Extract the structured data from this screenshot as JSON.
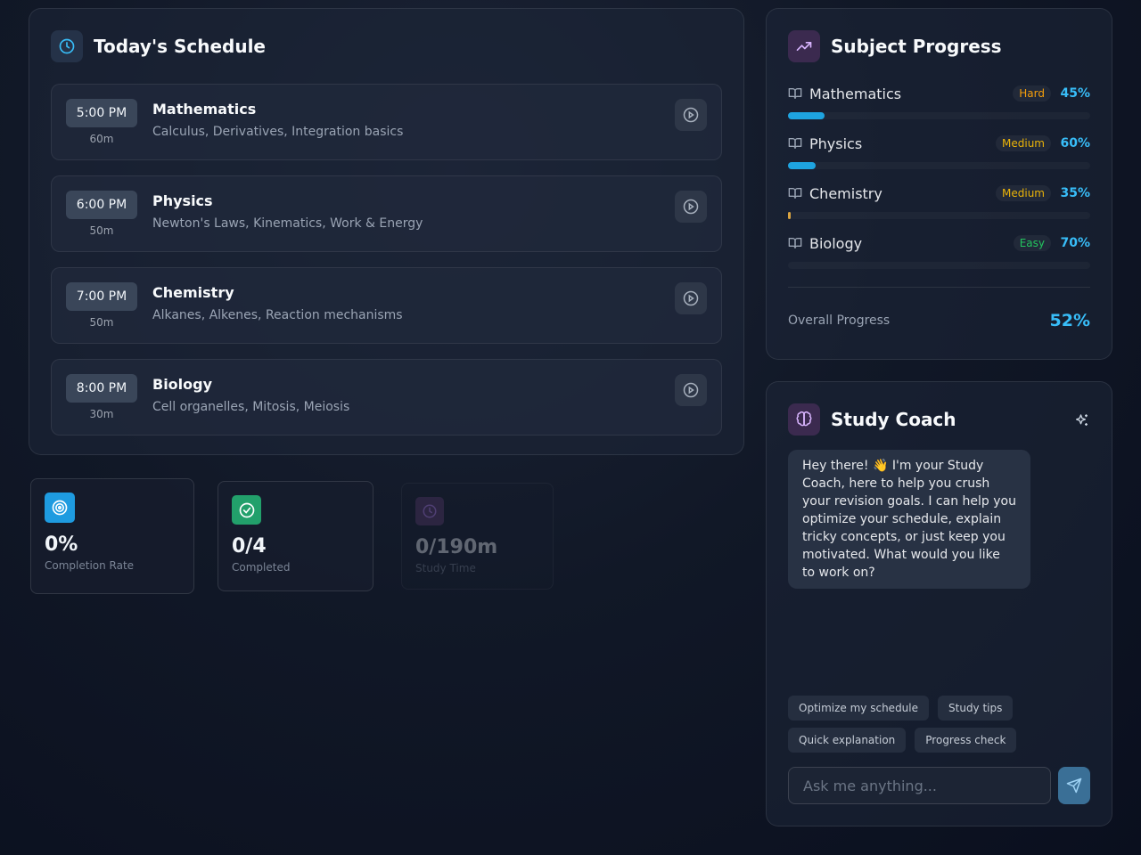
{
  "schedule": {
    "title": "Today's Schedule",
    "items": [
      {
        "time": "5:00 PM",
        "duration": "60m",
        "subject": "Mathematics",
        "topics": "Calculus, Derivatives, Integration basics"
      },
      {
        "time": "6:00 PM",
        "duration": "50m",
        "subject": "Physics",
        "topics": "Newton's Laws, Kinematics, Work & Energy"
      },
      {
        "time": "7:00 PM",
        "duration": "50m",
        "subject": "Chemistry",
        "topics": "Alkanes, Alkenes, Reaction mechanisms"
      },
      {
        "time": "8:00 PM",
        "duration": "30m",
        "subject": "Biology",
        "topics": "Cell organelles, Mitosis, Meiosis"
      }
    ]
  },
  "stats": [
    {
      "value": "0%",
      "label": "Completion Rate",
      "icon": "target-icon",
      "color": "#1e9be0"
    },
    {
      "value": "0/4",
      "label": "Completed",
      "icon": "check-circle-icon",
      "color": "#22a06b"
    },
    {
      "value": "0/190m",
      "label": "Study Time",
      "icon": "clock-icon",
      "color": "#5b3a6e"
    }
  ],
  "progress": {
    "title": "Subject Progress",
    "subjects": [
      {
        "name": "Mathematics",
        "difficulty": "Hard",
        "difficulty_color": "#f59e0b",
        "percent_label": "45%",
        "bar_fill": 0.12,
        "bar_color": "#1ea4e0"
      },
      {
        "name": "Physics",
        "difficulty": "Medium",
        "difficulty_color": "#eab308",
        "percent_label": "60%",
        "bar_fill": 0.09,
        "bar_color": "#1ea4e0"
      },
      {
        "name": "Chemistry",
        "difficulty": "Medium",
        "difficulty_color": "#eab308",
        "percent_label": "35%",
        "bar_fill": 0.01,
        "bar_color": "#d9a441"
      },
      {
        "name": "Biology",
        "difficulty": "Easy",
        "difficulty_color": "#22c55e",
        "percent_label": "70%",
        "bar_fill": 0.0,
        "bar_color": "#1ea4e0"
      }
    ],
    "overall_label": "Overall Progress",
    "overall_value": "52%"
  },
  "coach": {
    "title": "Study Coach",
    "message": "Hey there! 👋 I'm your Study Coach, here to help you crush your revision goals. I can help you optimize your schedule, explain tricky concepts, or just keep you motivated. What would you like to work on?",
    "chips": [
      "Optimize my schedule",
      "Study tips",
      "Quick explanation",
      "Progress check"
    ],
    "input_placeholder": "Ask me anything..."
  },
  "colors": {
    "accent": "#38bdf8",
    "card_bg": "#1e2638",
    "page_bg": "#111827"
  }
}
